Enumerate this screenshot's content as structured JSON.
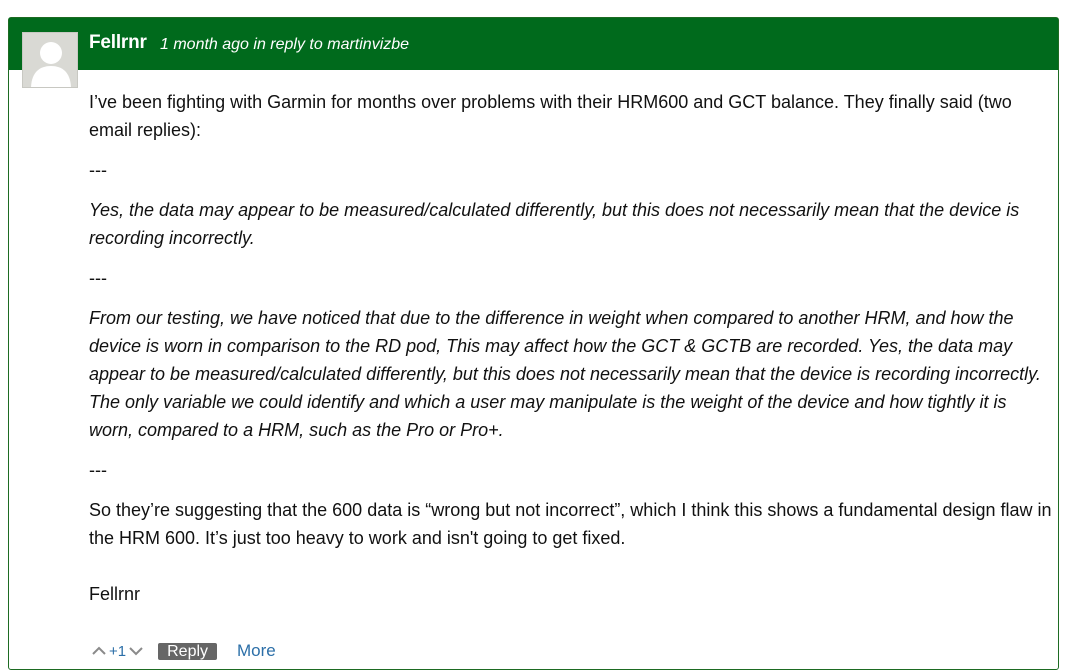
{
  "comment": {
    "author": "Fellrnr",
    "time_ago": "1 month ago",
    "reply_prefix": "in reply to",
    "reply_to": "martinvizbe",
    "paragraphs": [
      "I’ve been fighting with Garmin for months over problems with their HRM600 and GCT balance. They finally said (two email replies):",
      "---",
      "Yes, the data may appear to be measured/calculated differently, but this does not necessarily mean that the device is recording incorrectly.",
      "---",
      "From our testing, we have noticed that due to the difference in weight when compared to another HRM, and how the device is worn in comparison to the RD pod, This may affect how the GCT & GCTB are recorded.  Yes, the data may appear to be measured/calculated differently, but this does not necessarily mean that the device is recording incorrectly.  The only variable we could identify and which a user may manipulate is the weight of the device and how tightly it is worn, compared to a HRM, such as the Pro or Pro+.",
      "---",
      "So they’re suggesting that the 600 data is “wrong but not incorrect”, which I think this shows a fundamental design flaw in the HRM 600. It’s just too heavy to work and isn't going to get fixed.",
      "Fellrnr"
    ]
  },
  "footer": {
    "score": "+1",
    "reply_label": "Reply",
    "more_label": "More"
  },
  "colors": {
    "header_bg": "#006a1c",
    "link": "#2c6fa8",
    "reply_bg": "#666666"
  },
  "icons": {
    "avatar": "default-user-avatar",
    "vote_up": "chevron-up-icon",
    "vote_down": "chevron-down-icon"
  }
}
